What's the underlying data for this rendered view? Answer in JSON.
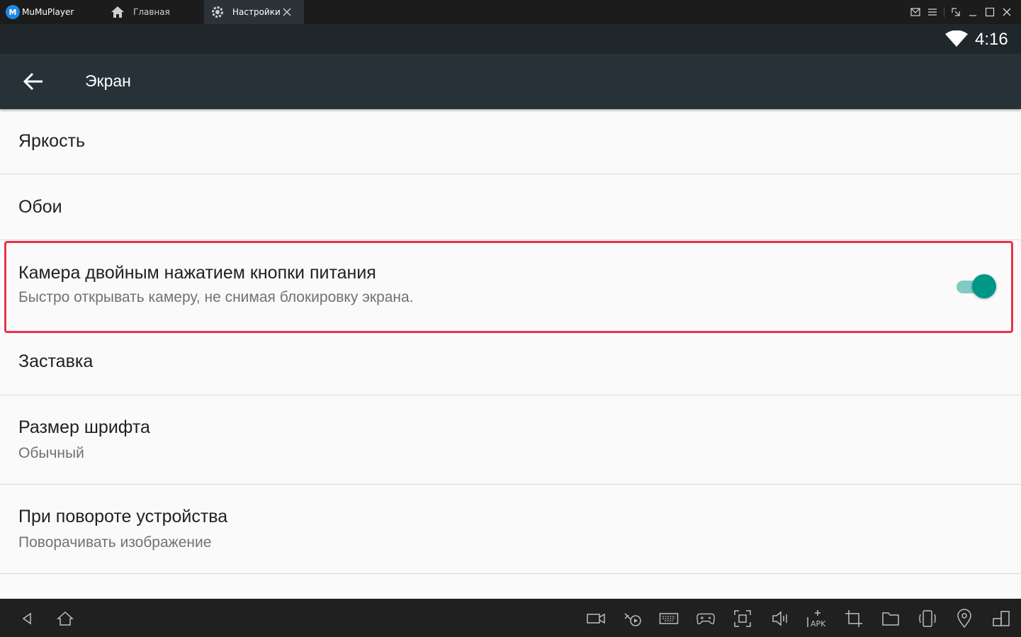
{
  "window": {
    "app_name": "MuMuPlayer",
    "logo_letter": "M",
    "tabs": [
      {
        "label": "Главная",
        "icon": "home-icon"
      },
      {
        "label": "Настройки",
        "icon": "gear-icon",
        "active": true
      }
    ],
    "controls": [
      "mail-icon",
      "menu-icon",
      "resize-icon",
      "minimize-icon",
      "maximize-icon",
      "close-icon"
    ]
  },
  "status_bar": {
    "time": "4:16",
    "icons": [
      "wifi-icon"
    ]
  },
  "app_bar": {
    "title": "Экран",
    "back_icon": "arrow-back-icon"
  },
  "settings": [
    {
      "title": "Яркость"
    },
    {
      "title": "Обои"
    },
    {
      "title": "Камера двойным нажатием кнопки питания",
      "subtitle": "Быстро открывать камеру, не снимая блокировку экрана.",
      "toggle": true,
      "toggle_on": true,
      "highlighted": true
    },
    {
      "title": "Заставка"
    },
    {
      "title": "Размер шрифта",
      "subtitle": "Обычный"
    },
    {
      "title": "При повороте устройства",
      "subtitle": "Поворачивать изображение"
    }
  ],
  "bottom_toolbar": {
    "nav": [
      "back-triangle-icon",
      "home-icon"
    ],
    "tools": [
      "video-record-icon",
      "operation-record-icon",
      "keyboard-icon",
      "gamepad-icon",
      "screenshot-icon",
      "volume-icon",
      "apk-install-icon",
      "crop-icon",
      "folder-icon",
      "rotate-icon",
      "location-icon",
      "multi-window-icon"
    ],
    "apk_label": "APK"
  },
  "colors": {
    "accent": "#009688",
    "accent_track": "#80cbc4",
    "highlight_border": "#e8334a",
    "appbar": "#263238",
    "statusbar": "#1f272b"
  }
}
